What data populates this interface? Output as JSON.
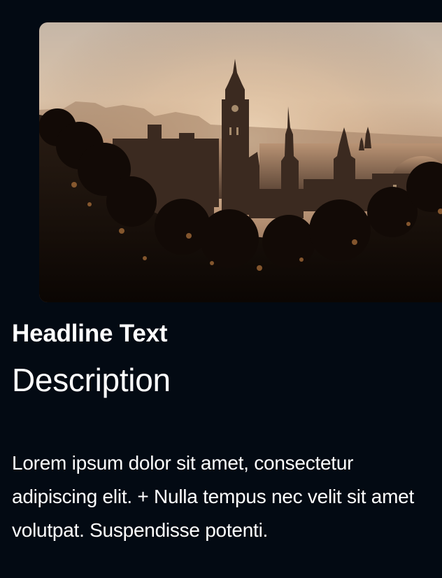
{
  "card": {
    "image": {
      "subject": "city-skyline-at-sunset"
    },
    "headline": "Headline Text",
    "description": "Description",
    "body": "Lorem ipsum dolor sit amet, consectetur adipiscing elit. + Nulla tempus nec velit sit amet volutpat. Suspendisse potenti."
  },
  "colors": {
    "background": "#030a13",
    "text": "#ffffff"
  }
}
